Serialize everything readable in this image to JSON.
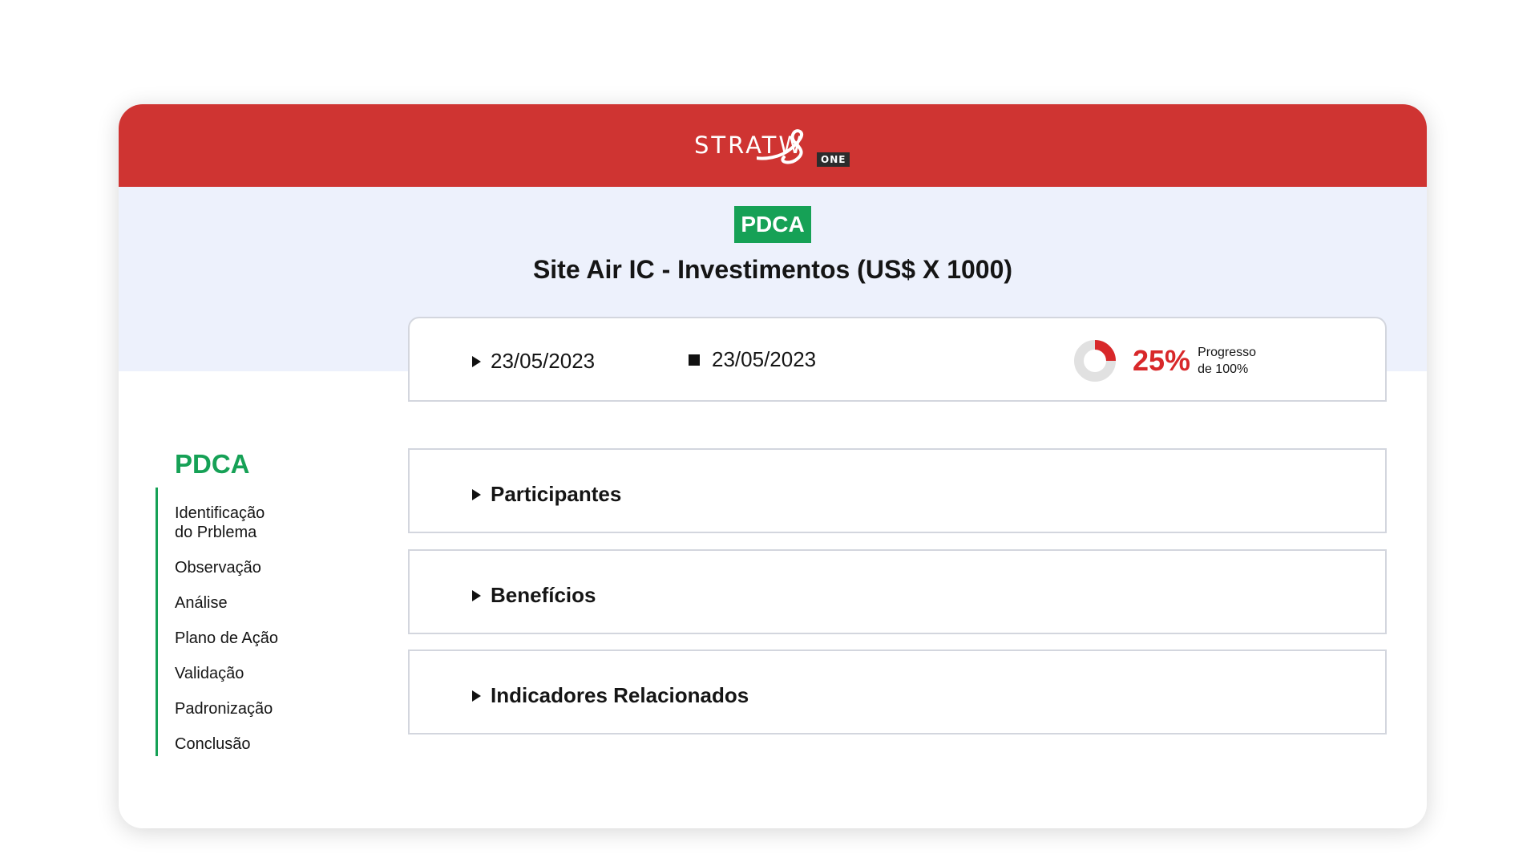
{
  "header": {
    "brand": "STRATW",
    "brand_suffix": "ONE",
    "brand_color": "#cf3432"
  },
  "badge": {
    "label": "PDCA",
    "color": "#16a156"
  },
  "page": {
    "title": "Site Air IC - Investimentos (US$ X 1000)"
  },
  "dates": {
    "start_icon": "play-icon",
    "start": "23/05/2023",
    "end_icon": "stop-icon",
    "end": "23/05/2023"
  },
  "progress": {
    "value": "25%",
    "fraction": 0.25,
    "label_line1": "Progresso",
    "label_line2": "de 100%",
    "color": "#d8282a"
  },
  "sidebar": {
    "title": "PDCA",
    "items": [
      {
        "line1": "Identificação",
        "line2": "do Prblema"
      },
      {
        "line1": "Observação"
      },
      {
        "line1": "Análise"
      },
      {
        "line1": "Plano de Ação"
      },
      {
        "line1": "Validação"
      },
      {
        "line1": "Padronização"
      },
      {
        "line1": "Conclusão"
      }
    ]
  },
  "sections": [
    {
      "label": "Participantes",
      "icon": "expand-arrow-icon"
    },
    {
      "label": "Benefícios",
      "icon": "expand-arrow-icon"
    },
    {
      "label": "Indicadores Relacionados",
      "icon": "expand-arrow-icon"
    }
  ]
}
